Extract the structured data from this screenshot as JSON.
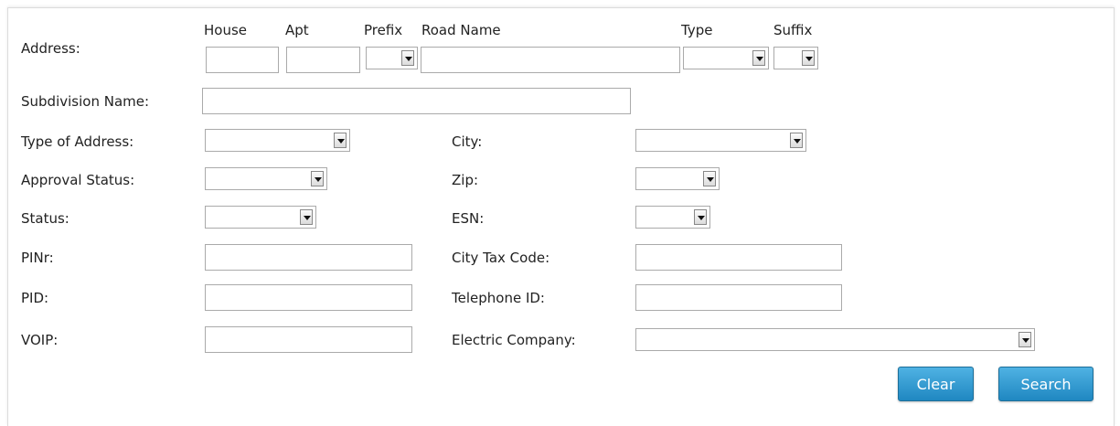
{
  "address": {
    "label": "Address:",
    "house_header": "House",
    "apt_header": "Apt",
    "prefix_header": "Prefix",
    "road_name_header": "Road Name",
    "type_header": "Type",
    "suffix_header": "Suffix",
    "house_value": "",
    "apt_value": "",
    "prefix_value": "",
    "road_name_value": "",
    "type_value": "",
    "suffix_value": ""
  },
  "subdivision": {
    "label": "Subdivision Name:",
    "value": ""
  },
  "left_fields": {
    "type_of_address": {
      "label": "Type of Address:",
      "value": ""
    },
    "approval_status": {
      "label": "Approval Status:",
      "value": ""
    },
    "status": {
      "label": "Status:",
      "value": ""
    },
    "pinr": {
      "label": "PINr:",
      "value": ""
    },
    "pid": {
      "label": "PID:",
      "value": ""
    },
    "voip": {
      "label": "VOIP:",
      "value": ""
    }
  },
  "right_fields": {
    "city": {
      "label": "City:",
      "value": ""
    },
    "zip": {
      "label": "Zip:",
      "value": ""
    },
    "esn": {
      "label": "ESN:",
      "value": ""
    },
    "city_tax_code": {
      "label": "City Tax Code:",
      "value": ""
    },
    "telephone_id": {
      "label": "Telephone ID:",
      "value": ""
    },
    "electric_company": {
      "label": "Electric Company:",
      "value": ""
    }
  },
  "buttons": {
    "clear": "Clear",
    "search": "Search"
  },
  "icons": {
    "dropdown": "chevron-down-icon"
  },
  "colors": {
    "button_top": "#4fb2e3",
    "button_bottom": "#1f87c1",
    "border": "#aaaaaa"
  }
}
